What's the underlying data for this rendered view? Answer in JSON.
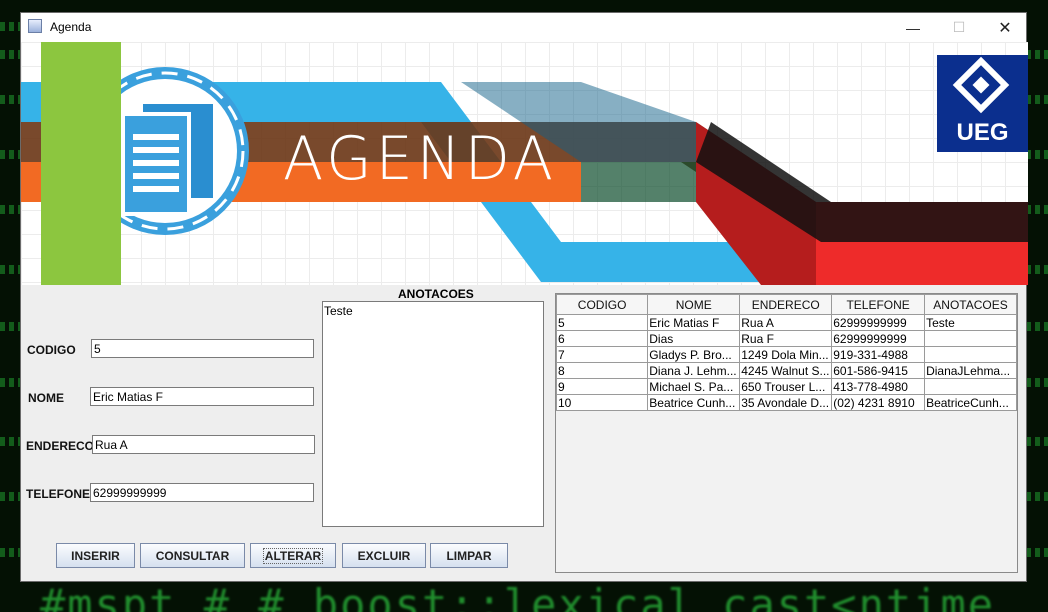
{
  "window": {
    "title": "Agenda"
  },
  "banner": {
    "title": "AGENDA",
    "logo_text": "UEG"
  },
  "form": {
    "codigo_label": "CODIGO",
    "codigo_value": "5",
    "nome_label": "NOME",
    "nome_value": "Eric Matias F",
    "endereco_label": "ENDERECO",
    "endereco_value": "Rua A",
    "telefone_label": "TELEFONE",
    "telefone_value": "62999999999",
    "anotacoes_label": "ANOTACOES",
    "anotacoes_value": "Teste"
  },
  "buttons": {
    "inserir": "INSERIR",
    "consultar": "CONSULTAR",
    "alterar": "ALTERAR",
    "excluir": "EXCLUIR",
    "limpar": "LIMPAR"
  },
  "table": {
    "columns": [
      "CODIGO",
      "NOME",
      "ENDERECO",
      "TELEFONE",
      "ANOTACOES"
    ],
    "rows": [
      [
        "5",
        "Eric Matias F",
        "Rua A",
        "62999999999",
        "Teste"
      ],
      [
        "6",
        "Dias",
        "Rua F",
        "62999999999",
        ""
      ],
      [
        "7",
        "Gladys P. Bro...",
        "1249 Dola Min...",
        "919-331-4988",
        ""
      ],
      [
        "8",
        "Diana J. Lehm...",
        "4245 Walnut S...",
        "601-586-9415",
        "DianaJLehma..."
      ],
      [
        "9",
        "Michael S. Pa...",
        "650 Trouser L...",
        "413-778-4980",
        ""
      ],
      [
        "10",
        "Beatrice Cunh...",
        "35 Avondale D...",
        "(02) 4231 8910",
        "BeatriceCunh..."
      ]
    ]
  },
  "desktop": {
    "bottom_text": "#mspt # # boost::lexical_cast<ntime"
  }
}
